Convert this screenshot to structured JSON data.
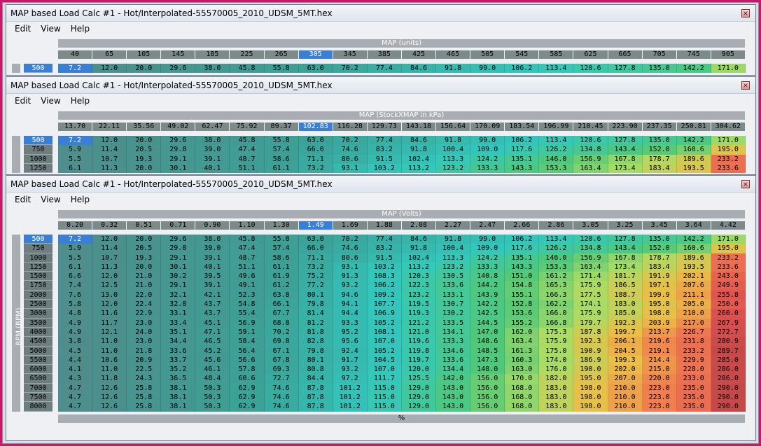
{
  "windows": [
    {
      "title": "MAP based Load Calc #1 - Hot/Interpolated-55570005_2010_UDSM_5MT.hex",
      "menu": [
        "Edit",
        "View",
        "Help"
      ],
      "axis_label": "MAP (units)",
      "headers": [
        "40",
        "65",
        "105",
        "145",
        "185",
        "225",
        "265",
        "305",
        "345",
        "385",
        "425",
        "465",
        "505",
        "545",
        "585",
        "625",
        "665",
        "705",
        "745",
        "905"
      ],
      "selected_col": 7,
      "rpm": [
        "500"
      ]
    },
    {
      "title": "MAP based Load Calc #1 - Hot/Interpolated-55570005_2010_UDSM_5MT.hex",
      "menu": [
        "Edit",
        "View",
        "Help"
      ],
      "axis_label": "MAP (StockXMAP in kPa)",
      "headers": [
        "13.70",
        "22.11",
        "35.56",
        "49.02",
        "62.47",
        "75.92",
        "89.37",
        "102.83",
        "116.28",
        "129.73",
        "143.18",
        "156.64",
        "170.09",
        "183.54",
        "196.99",
        "210.45",
        "223.90",
        "237.35",
        "250.81",
        "304.62"
      ],
      "selected_col": 7,
      "rpm": [
        "500",
        "750",
        "1000",
        "1250"
      ]
    },
    {
      "title": "MAP based Load Calc #1 - Hot/Interpolated-55570005_2010_UDSM_5MT.hex",
      "menu": [
        "Edit",
        "View",
        "Help"
      ],
      "axis_label": "MAP (Volts)",
      "headers": [
        "0.20",
        "0.32",
        "0.51",
        "0.71",
        "0.90",
        "1.10",
        "1.30",
        "1.49",
        "1.69",
        "1.88",
        "2.08",
        "2.27",
        "2.47",
        "2.66",
        "2.86",
        "3.05",
        "3.25",
        "3.45",
        "3.64",
        "4.42"
      ],
      "selected_col": 7,
      "rpm": [
        "500",
        "750",
        "1000",
        "1250",
        "1500",
        "1750",
        "2000",
        "2500",
        "3000",
        "3500",
        "4000",
        "4500",
        "5000",
        "5500",
        "6000",
        "6500",
        "7000",
        "7500",
        "8000"
      ],
      "y_label": "RPM (RPM)",
      "x_label": "%"
    }
  ],
  "table": [
    [
      "7.2",
      "12.0",
      "20.0",
      "29.6",
      "38.0",
      "45.8",
      "55.8",
      "63.0",
      "70.2",
      "77.4",
      "84.6",
      "91.8",
      "99.0",
      "106.2",
      "113.4",
      "120.6",
      "127.8",
      "135.0",
      "142.2",
      "171.0"
    ],
    [
      "5.9",
      "11.4",
      "20.5",
      "29.8",
      "39.0",
      "47.4",
      "57.4",
      "66.0",
      "74.6",
      "83.2",
      "91.8",
      "100.4",
      "109.0",
      "117.6",
      "126.2",
      "134.8",
      "143.4",
      "152.0",
      "160.6",
      "195.0"
    ],
    [
      "5.5",
      "10.7",
      "19.3",
      "29.1",
      "39.1",
      "48.7",
      "58.6",
      "71.1",
      "80.6",
      "91.5",
      "102.4",
      "113.3",
      "124.2",
      "135.1",
      "146.0",
      "156.9",
      "167.8",
      "178.7",
      "189.6",
      "233.2"
    ],
    [
      "6.1",
      "11.3",
      "20.0",
      "30.1",
      "40.1",
      "51.1",
      "61.1",
      "73.2",
      "93.1",
      "103.2",
      "113.2",
      "123.2",
      "133.3",
      "143.3",
      "153.3",
      "163.4",
      "173.4",
      "183.4",
      "193.5",
      "233.6"
    ],
    [
      "6.6",
      "12.0",
      "21.0",
      "30.2",
      "39.5",
      "49.6",
      "61.9",
      "75.2",
      "91.3",
      "108.3",
      "120.3",
      "130.5",
      "140.8",
      "151.0",
      "161.2",
      "171.4",
      "181.7",
      "191.9",
      "202.1",
      "243.0"
    ],
    [
      "7.4",
      "12.5",
      "21.0",
      "29.1",
      "39.1",
      "49.1",
      "61.2",
      "77.2",
      "93.2",
      "106.2",
      "122.3",
      "133.6",
      "144.2",
      "154.8",
      "165.3",
      "175.9",
      "186.5",
      "197.1",
      "207.6",
      "249.9"
    ],
    [
      "7.6",
      "13.0",
      "22.0",
      "32.1",
      "42.1",
      "52.3",
      "63.8",
      "80.1",
      "94.6",
      "109.2",
      "123.2",
      "133.1",
      "143.9",
      "155.1",
      "166.3",
      "177.5",
      "188.7",
      "199.9",
      "211.1",
      "255.8"
    ],
    [
      "5.8",
      "12.0",
      "22.4",
      "32.8",
      "43.7",
      "54.8",
      "66.1",
      "79.8",
      "94.1",
      "107.7",
      "119.5",
      "130.7",
      "142.2",
      "152.8",
      "162.2",
      "174.1",
      "183.0",
      "195.0",
      "205.0",
      "250.0"
    ],
    [
      "4.8",
      "11.6",
      "22.9",
      "33.1",
      "43.7",
      "55.4",
      "67.7",
      "81.4",
      "94.4",
      "106.9",
      "119.3",
      "130.2",
      "142.5",
      "153.6",
      "166.0",
      "175.9",
      "185.0",
      "198.0",
      "210.0",
      "260.0"
    ],
    [
      "4.9",
      "11.7",
      "23.0",
      "33.4",
      "45.1",
      "56.9",
      "68.8",
      "81.2",
      "93.3",
      "105.2",
      "121.2",
      "133.5",
      "144.5",
      "155.2",
      "166.8",
      "179.7",
      "192.3",
      "203.9",
      "217.0",
      "267.9"
    ],
    [
      "4.9",
      "12.1",
      "24.0",
      "35.1",
      "47.1",
      "59.1",
      "70.2",
      "81.8",
      "95.2",
      "108.1",
      "121.0",
      "134.1",
      "147.0",
      "162.0",
      "175.3",
      "187.8",
      "199.7",
      "213.7",
      "226.7",
      "272.7"
    ],
    [
      "3.8",
      "11.0",
      "23.0",
      "34.4",
      "46.5",
      "58.4",
      "69.8",
      "82.8",
      "95.6",
      "107.0",
      "119.6",
      "133.3",
      "148.6",
      "163.4",
      "175.9",
      "192.3",
      "206.1",
      "219.6",
      "231.8",
      "280.9"
    ],
    [
      "4.5",
      "11.0",
      "21.8",
      "33.6",
      "45.2",
      "56.4",
      "67.1",
      "79.8",
      "92.4",
      "105.2",
      "119.8",
      "134.6",
      "148.5",
      "161.3",
      "175.0",
      "190.9",
      "204.5",
      "219.1",
      "233.2",
      "289.7"
    ],
    [
      "4.4",
      "10.6",
      "20.9",
      "33.7",
      "45.6",
      "56.6",
      "67.8",
      "80.1",
      "91.7",
      "104.5",
      "119.7",
      "133.6",
      "147.3",
      "160.3",
      "174.0",
      "186.9",
      "199.3",
      "214.4",
      "229.9",
      "285.0"
    ],
    [
      "4.1",
      "11.0",
      "22.5",
      "35.2",
      "46.1",
      "57.8",
      "69.3",
      "80.8",
      "93.2",
      "107.0",
      "120.0",
      "134.4",
      "148.0",
      "163.0",
      "176.0",
      "190.0",
      "202.0",
      "215.0",
      "228.0",
      "286.0"
    ],
    [
      "4.3",
      "11.8",
      "24.3",
      "36.5",
      "48.4",
      "60.6",
      "72.7",
      "84.4",
      "97.2",
      "111.7",
      "125.5",
      "142.0",
      "156.0",
      "170.0",
      "182.0",
      "195.0",
      "207.0",
      "220.0",
      "233.0",
      "286.0"
    ],
    [
      "4.7",
      "12.6",
      "25.8",
      "38.1",
      "50.3",
      "62.9",
      "74.6",
      "87.8",
      "101.2",
      "115.0",
      "129.0",
      "143.0",
      "156.0",
      "168.0",
      "183.0",
      "198.0",
      "210.0",
      "223.0",
      "235.0",
      "290.0"
    ],
    [
      "4.7",
      "12.6",
      "25.8",
      "38.1",
      "50.3",
      "62.9",
      "74.6",
      "87.8",
      "101.2",
      "115.0",
      "129.0",
      "143.0",
      "156.0",
      "168.0",
      "183.0",
      "198.0",
      "210.0",
      "223.0",
      "235.0",
      "290.0"
    ],
    [
      "4.7",
      "12.6",
      "25.8",
      "38.1",
      "50.3",
      "62.9",
      "74.6",
      "87.8",
      "101.2",
      "115.0",
      "129.0",
      "143.0",
      "156.0",
      "168.0",
      "183.0",
      "198.0",
      "210.0",
      "223.0",
      "235.0",
      "290.0"
    ]
  ],
  "colors": {
    "selected": "#3a7fd6",
    "background": "#c8186a"
  }
}
